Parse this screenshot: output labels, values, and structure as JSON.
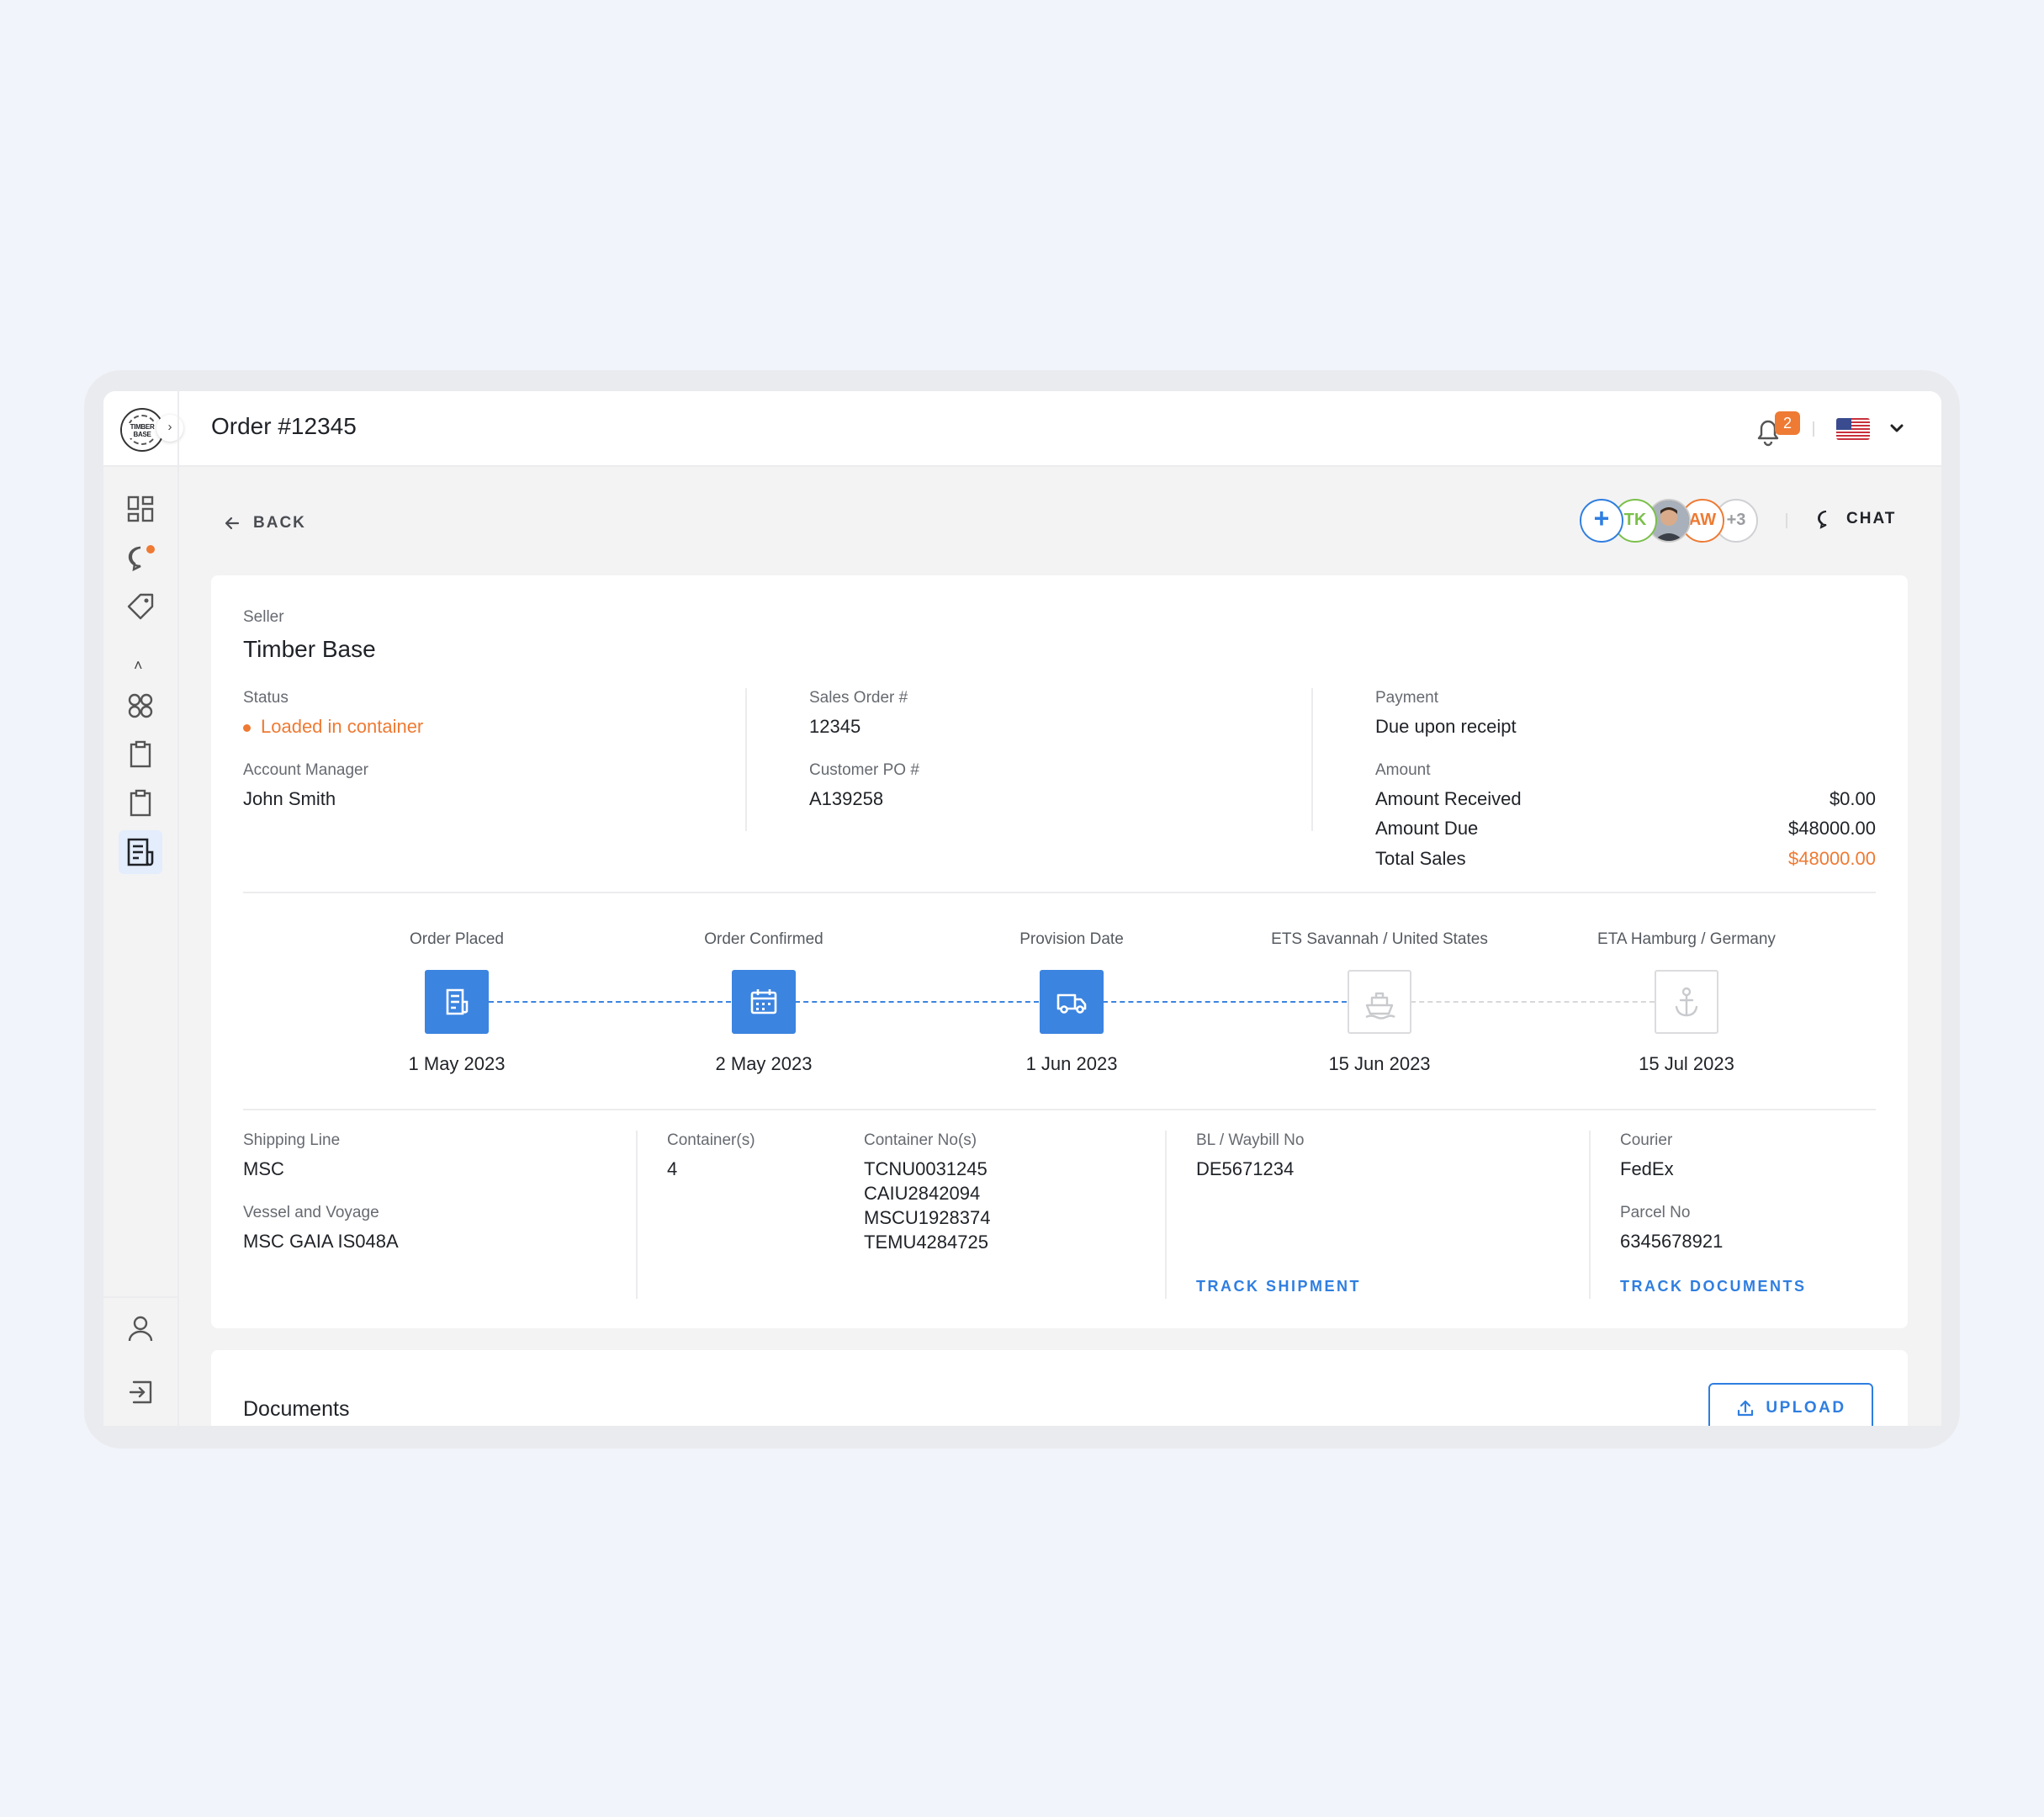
{
  "header": {
    "logo_text": "TIMBER BASE",
    "page_title": "Order #12345",
    "notification_count": "2",
    "language": "us-flag-icon"
  },
  "toolbar": {
    "back_label": "BACK",
    "chat_label": "CHAT",
    "avatars": [
      {
        "initials": "TK",
        "color": "#7bc04a"
      },
      {
        "initials": "AW",
        "color": "#ee7a33"
      },
      {
        "initials": "+3",
        "color": "#9a9ca0"
      }
    ]
  },
  "order": {
    "seller_label": "Seller",
    "seller": "Timber Base",
    "status_label": "Status",
    "status": "Loaded in container",
    "account_manager_label": "Account Manager",
    "account_manager": "John Smith",
    "sales_order_label": "Sales Order #",
    "sales_order": "12345",
    "customer_po_label": "Customer PO #",
    "customer_po": "A139258",
    "payment_label": "Payment",
    "payment": "Due upon receipt",
    "amount_label": "Amount",
    "amount_received_label": "Amount Received",
    "amount_received": "$0.00",
    "amount_due_label": "Amount Due",
    "amount_due": "$48000.00",
    "total_sales_label": "Total Sales",
    "total_sales": "$48000.00"
  },
  "timeline": [
    {
      "label": "Order Placed",
      "date": "1 May 2023",
      "icon": "document-icon",
      "done": true
    },
    {
      "label": "Order Confirmed",
      "date": "2 May 2023",
      "icon": "calendar-icon",
      "done": true
    },
    {
      "label": "Provision Date",
      "date": "1 Jun 2023",
      "icon": "truck-icon",
      "done": true
    },
    {
      "label": "ETS Savannah / United States",
      "date": "15 Jun 2023",
      "icon": "ship-icon",
      "done": false
    },
    {
      "label": "ETA Hamburg / Germany",
      "date": "15 Jul 2023",
      "icon": "anchor-icon",
      "done": false
    }
  ],
  "shipping": {
    "shipping_line_label": "Shipping Line",
    "shipping_line": "MSC",
    "vessel_label": "Vessel and Voyage",
    "vessel": "MSC GAIA IS048A",
    "containers_label": "Container(s)",
    "containers": "4",
    "container_nos_label": "Container No(s)",
    "container_nos": [
      "TCNU0031245",
      "CAIU2842094",
      "MSCU1928374",
      "TEMU4284725"
    ],
    "bl_label": "BL / Waybill No",
    "bl": "DE5671234",
    "track_shipment": "TRACK SHIPMENT",
    "courier_label": "Courier",
    "courier": "FedEx",
    "parcel_label": "Parcel No",
    "parcel": "6345678921",
    "track_documents": "TRACK DOCUMENTS"
  },
  "documents": {
    "title": "Documents",
    "upload_label": "UPLOAD"
  },
  "colors": {
    "accent": "#2f7ee0",
    "status": "#ee7a33"
  }
}
